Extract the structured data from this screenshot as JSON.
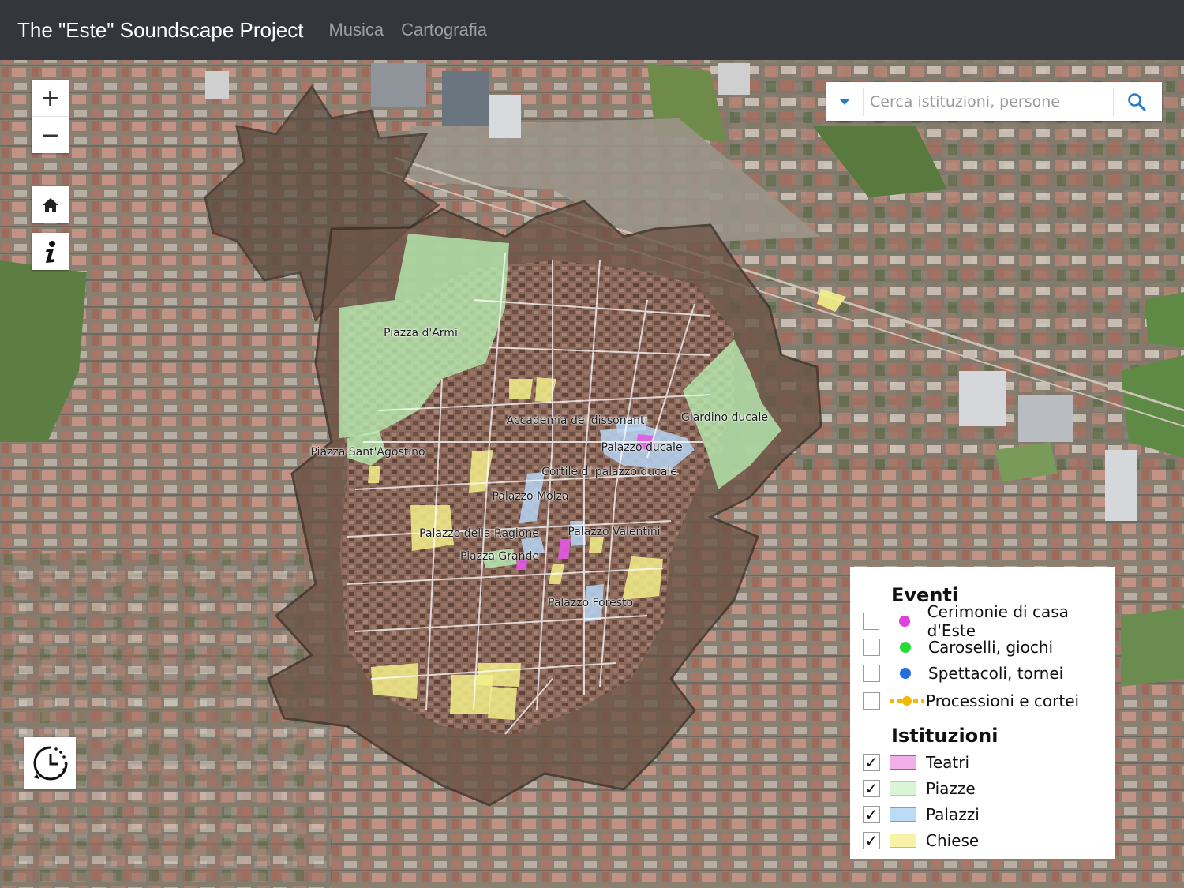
{
  "header": {
    "brand": "The \"Este\" Soundscape Project",
    "nav": [
      {
        "label": "Musica"
      },
      {
        "label": "Cartografia"
      }
    ]
  },
  "map_controls": {
    "zoom_in": "+",
    "zoom_out": "−",
    "home_icon": "home-icon",
    "info_icon": "info-icon",
    "clock_icon": "history-clock-icon"
  },
  "search": {
    "placeholder": "Cerca istituzioni, persone",
    "dropdown_icon": "caret-down-icon",
    "button_icon": "search-icon"
  },
  "places": [
    {
      "name": "Piazza d'Armi"
    },
    {
      "name": "Giardino ducale"
    },
    {
      "name": "Accademia dei dissonanti"
    },
    {
      "name": "Palazzo ducale"
    },
    {
      "name": "Piazza Sant'Agostino"
    },
    {
      "name": "Cortile di palazzo ducale"
    },
    {
      "name": "Palazzo Molza"
    },
    {
      "name": "Palazzo della Ragione"
    },
    {
      "name": "Palazzo Valentini"
    },
    {
      "name": "Piazza Grande"
    },
    {
      "name": "Palazzo Foresto"
    }
  ],
  "legend": {
    "eventi_title": "Eventi",
    "eventi": [
      {
        "label": "Cerimonie di casa d'Este",
        "color": "#e040e0",
        "checked": false
      },
      {
        "label": "Caroselli, giochi",
        "color": "#22dd33",
        "checked": false
      },
      {
        "label": "Spettacoli, tornei",
        "color": "#1f6fe0",
        "checked": false
      },
      {
        "label": "Processioni e cortei",
        "color": "#f5b800",
        "checked": false
      }
    ],
    "istituzioni_title": "Istituzioni",
    "istituzioni": [
      {
        "label": "Teatri",
        "color": "#f2aee8",
        "checked": true
      },
      {
        "label": "Piazze",
        "color": "#d8f5d8",
        "checked": true
      },
      {
        "label": "Palazzi",
        "color": "#bcdcf5",
        "checked": true
      },
      {
        "label": "Chiese",
        "color": "#f7f2a6",
        "checked": true
      }
    ],
    "check_mark": "✓"
  }
}
